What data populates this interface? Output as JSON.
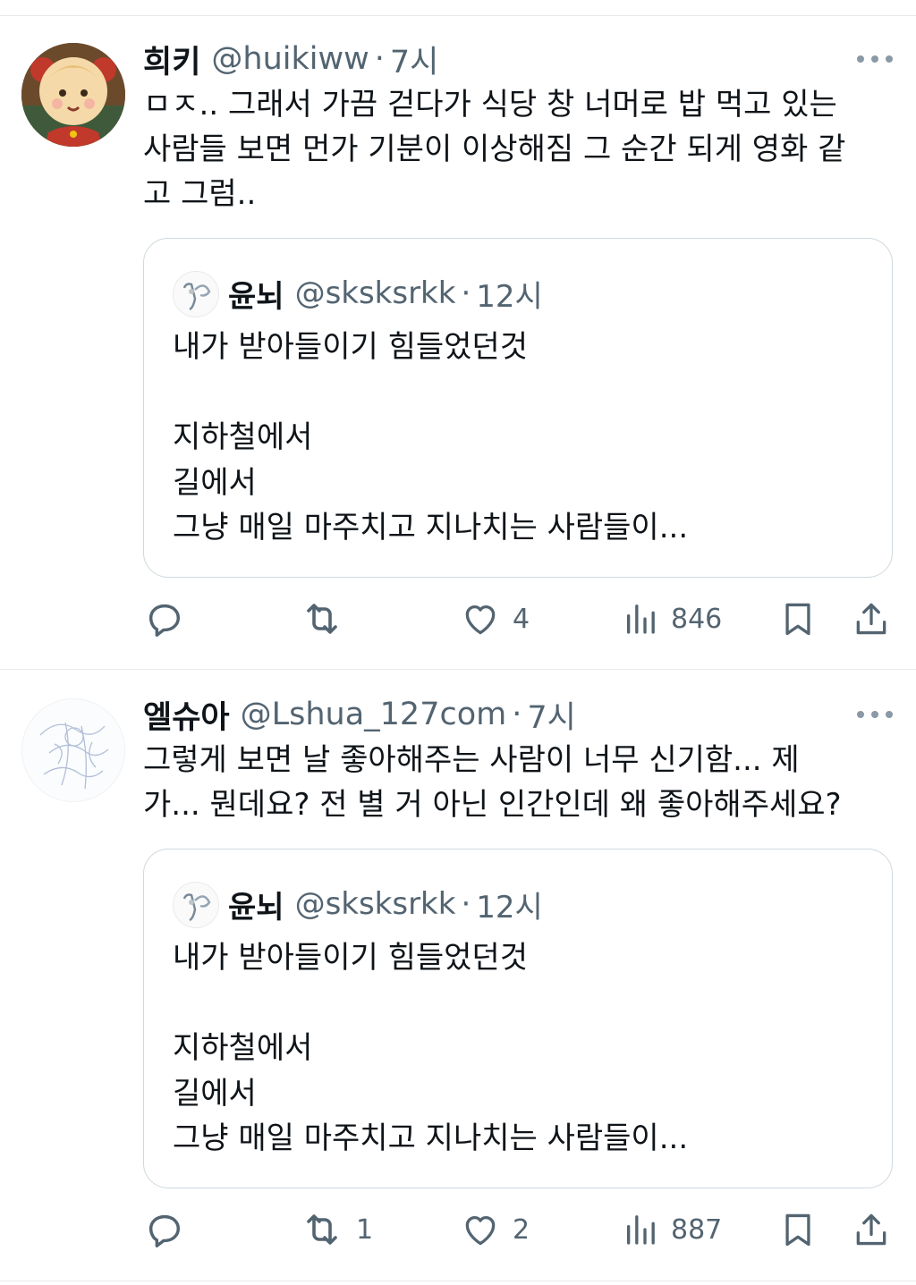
{
  "tweets": [
    {
      "author_name": "희키",
      "handle": "@huikiww",
      "separator": "·",
      "time": "7시",
      "text_lines": [
        "ㅁㅈ.. 그래서 가끔 걷다가 식당 창 너머로 밥 먹고 있는",
        "사람들 보면 먼가 기분이 이상해짐 그 순간 되게 영화 같",
        "고 그럼.."
      ],
      "quote": {
        "author_name": "윤뇌",
        "handle": "@sksksrkk",
        "separator": "·",
        "time": "12시",
        "lines": [
          "내가 받아들이기 힘들었던것",
          "",
          "지하철에서",
          "길에서",
          "그냥 매일 마주치고 지나치는 사람들이..."
        ]
      },
      "stats": {
        "replies": "",
        "retweets": "",
        "likes": "4",
        "views": "846"
      }
    },
    {
      "author_name": "엘슈아",
      "handle": "@Lshua_127com",
      "separator": "·",
      "time": "7시",
      "text_lines": [
        "그렇게 보면 날 좋아해주는 사람이 너무 신기함... 제",
        "가... 뭔데요? 전 별 거 아닌 인간인데 왜 좋아해주세요?"
      ],
      "quote": {
        "author_name": "윤뇌",
        "handle": "@sksksrkk",
        "separator": "·",
        "time": "12시",
        "lines": [
          "내가 받아들이기 힘들었던것",
          "",
          "지하철에서",
          "길에서",
          "그냥 매일 마주치고 지나치는 사람들이..."
        ]
      },
      "stats": {
        "replies": "",
        "retweets": "1",
        "likes": "2",
        "views": "887"
      }
    }
  ],
  "icons": {
    "more": "more-dots-icon",
    "reply": "reply-icon",
    "retweet": "retweet-icon",
    "like": "heart-icon",
    "views": "analytics-icon",
    "bookmark": "bookmark-icon",
    "share": "share-icon"
  },
  "colors": {
    "text": "#0f1419",
    "secondary": "#536471",
    "border": "#cfd9de",
    "divider": "#e7e9ea"
  }
}
